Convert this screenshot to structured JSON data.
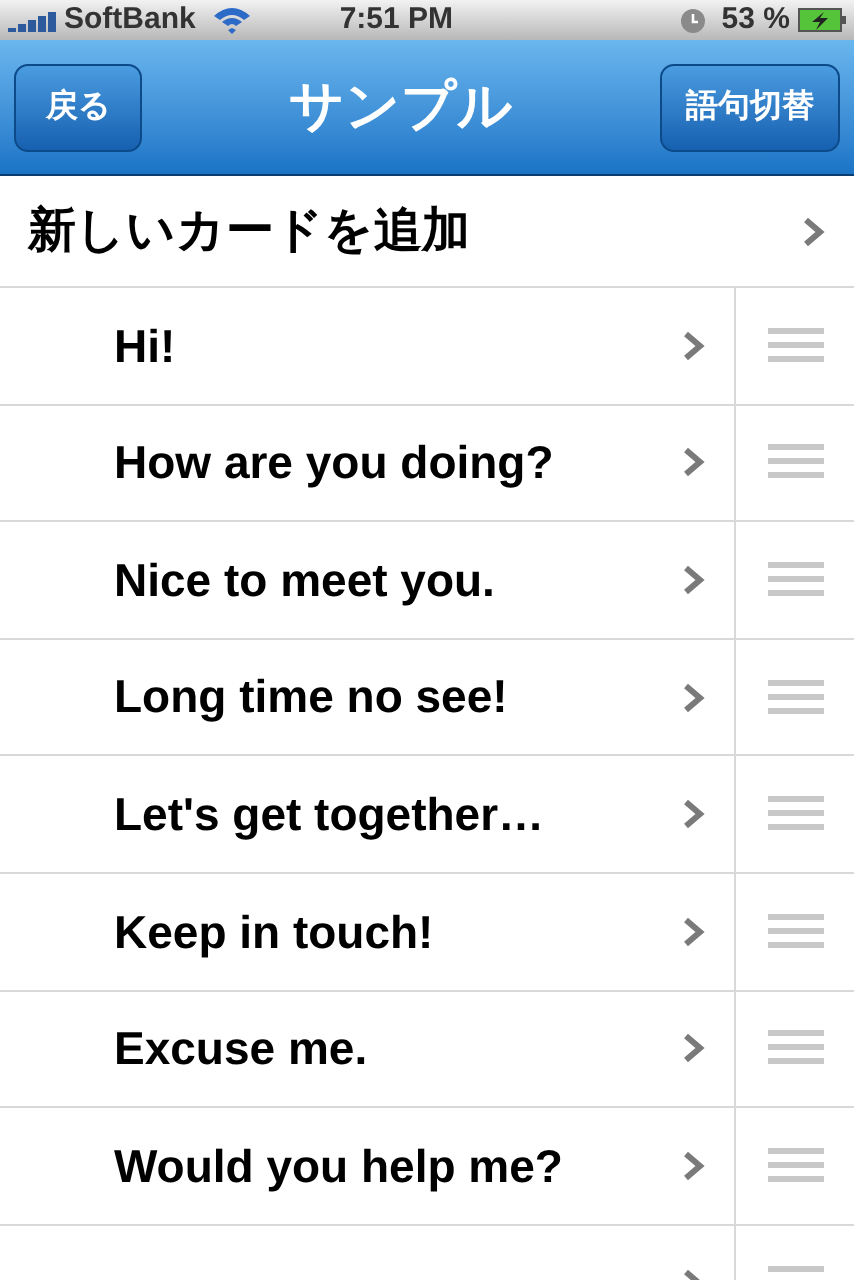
{
  "status_bar": {
    "carrier": "SoftBank",
    "time": "7:51 PM",
    "battery": "53 %"
  },
  "nav_bar": {
    "back": "戻る",
    "title": "サンプル",
    "action": "語句切替"
  },
  "add_row": {
    "label": "新しいカードを追加"
  },
  "phrases": [
    {
      "kind": "phrase",
      "text": "Hi!"
    },
    {
      "kind": "phrase",
      "text": "How are you doing?"
    },
    {
      "kind": "phrase",
      "text": "Nice to meet you."
    },
    {
      "kind": "phrase",
      "text": "Long time no see!"
    },
    {
      "kind": "phrase",
      "text": "Let's get together…"
    },
    {
      "kind": "phrase",
      "text": "Keep in touch!"
    },
    {
      "kind": "phrase",
      "text": "Excuse me."
    },
    {
      "kind": "phrase",
      "text": "Would you help me?"
    },
    {
      "kind": "cut_off"
    }
  ]
}
